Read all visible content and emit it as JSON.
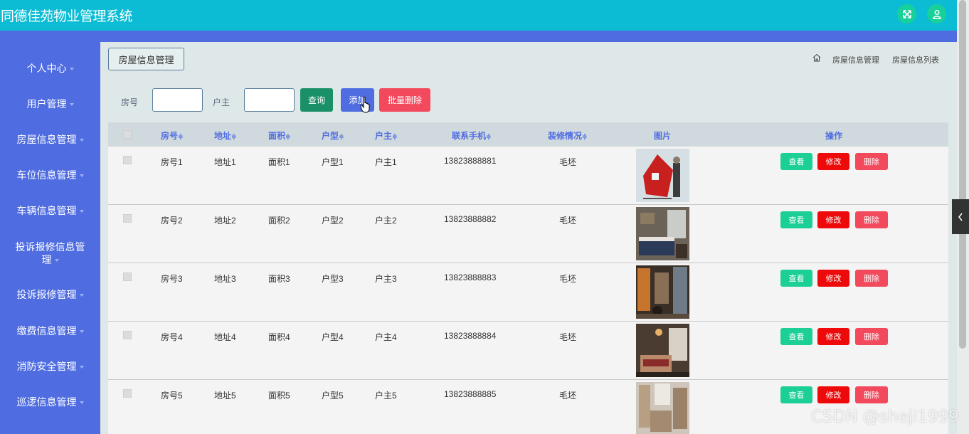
{
  "app": {
    "title": "同德佳苑物业管理系统"
  },
  "icons": {
    "fullscreen": "fullscreen-icon",
    "user": "user-icon",
    "home": "home-icon"
  },
  "colors": {
    "header": "#0bbcd4",
    "sidebar": "#4f6de0",
    "view": "#1bcf96",
    "edit": "#ee0a0a",
    "delete": "#f24a5c",
    "query": "#1a9068"
  },
  "sidebar": {
    "items": [
      {
        "label": "个人中心"
      },
      {
        "label": "用户管理"
      },
      {
        "label": "房屋信息管理"
      },
      {
        "label": "车位信息管理"
      },
      {
        "label": "车辆信息管理"
      },
      {
        "label": "投诉报修信息管理"
      },
      {
        "label": "投诉报修管理"
      },
      {
        "label": "缴费信息管理"
      },
      {
        "label": "消防安全管理"
      },
      {
        "label": "巡逻信息管理"
      }
    ]
  },
  "page": {
    "title_button": "房屋信息管理",
    "breadcrumb": [
      "房屋信息管理",
      "房屋信息列表"
    ]
  },
  "search": {
    "room_label": "房号",
    "room_value": "",
    "owner_label": "户主",
    "owner_value": "",
    "query_label": "查询",
    "add_label": "添加",
    "batch_delete_label": "批量删除"
  },
  "table": {
    "headers": [
      "房号",
      "地址",
      "面积",
      "户型",
      "户主",
      "联系手机",
      "装修情况",
      "图片",
      "操作"
    ],
    "sort_mark": "≑",
    "rows": [
      {
        "room": "房号1",
        "address": "地址1",
        "area": "面积1",
        "layout": "户型1",
        "owner": "户主1",
        "phone": "13823888881",
        "decor": "毛坯"
      },
      {
        "room": "房号2",
        "address": "地址2",
        "area": "面积2",
        "layout": "户型2",
        "owner": "户主2",
        "phone": "13823888882",
        "decor": "毛坯"
      },
      {
        "room": "房号3",
        "address": "地址3",
        "area": "面积3",
        "layout": "户型3",
        "owner": "户主3",
        "phone": "13823888883",
        "decor": "毛坯"
      },
      {
        "room": "房号4",
        "address": "地址4",
        "area": "面积4",
        "layout": "户型4",
        "owner": "户主4",
        "phone": "13823888884",
        "decor": "毛坯"
      },
      {
        "room": "房号5",
        "address": "地址5",
        "area": "面积5",
        "layout": "户型5",
        "owner": "户主5",
        "phone": "13823888885",
        "decor": "毛坯"
      }
    ],
    "actions": {
      "view": "查看",
      "edit": "修改",
      "delete": "删除"
    }
  },
  "watermark": "CSDN @sheji1999"
}
